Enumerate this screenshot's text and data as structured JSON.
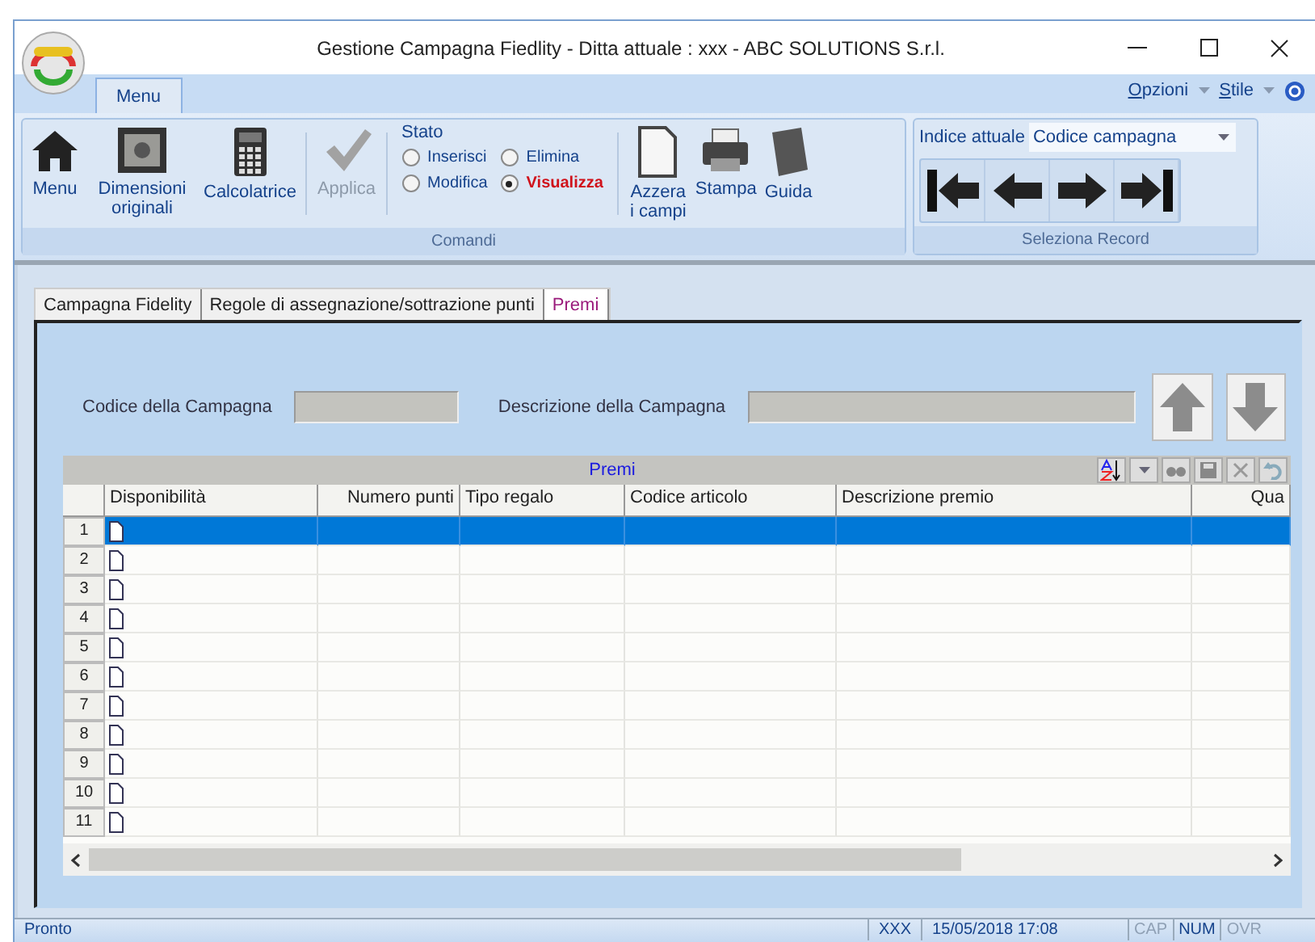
{
  "window": {
    "title": "Gestione Campagna Fiedlity - Ditta attuale : xxx - ABC SOLUTIONS S.r.l."
  },
  "ribbon_tabs": [
    {
      "label": "Menu",
      "selected": true
    }
  ],
  "ribbon_menu": [
    {
      "label": "Opzioni"
    },
    {
      "label": "Stile"
    }
  ],
  "commands": {
    "caption": "Comandi",
    "buttons": [
      {
        "kind": "home",
        "label": "Menu",
        "disabled": false
      },
      {
        "kind": "frame",
        "label": "Dimensioni originali",
        "disabled": false
      },
      {
        "kind": "calculator",
        "label": "Calcolatrice",
        "disabled": false
      },
      {
        "kind": "check",
        "label": "Applica",
        "disabled": true
      }
    ],
    "state_title": "Stato",
    "states": [
      {
        "label": "Inserisci",
        "selected": false
      },
      {
        "label": "Elimina",
        "selected": false
      },
      {
        "label": "Modifica",
        "selected": false
      },
      {
        "label": "Visualizza",
        "selected": true
      }
    ],
    "tools": [
      {
        "kind": "page",
        "label": "Azzera i campi"
      },
      {
        "kind": "printer",
        "label": "Stampa"
      },
      {
        "kind": "book",
        "label": "Guida"
      }
    ]
  },
  "record": {
    "caption": "Seleziona Record",
    "index_label": "Indice attuale",
    "index_value": "Codice campagna",
    "nav": [
      {
        "kind": "first"
      },
      {
        "kind": "prev"
      },
      {
        "kind": "next"
      },
      {
        "kind": "last"
      }
    ]
  },
  "tabs": [
    {
      "label": "Campagna Fidelity",
      "selected": false
    },
    {
      "label": "Regole di assegnazione/sottrazione punti",
      "selected": false
    },
    {
      "label": "Premi",
      "selected": true
    }
  ],
  "fields": [
    {
      "label": "Codice della Campagna"
    },
    {
      "label": "Descrizione della Campagna"
    }
  ],
  "grid": {
    "caption": "Premi",
    "columns": [
      {
        "label": "Disponibilità",
        "kind": "text"
      },
      {
        "label": "Numero punti",
        "kind": "number"
      },
      {
        "label": "Tipo regalo",
        "kind": "text"
      },
      {
        "label": "Codice articolo",
        "kind": "text"
      },
      {
        "label": "Descrizione premio",
        "kind": "text"
      },
      {
        "label": "Qua",
        "kind": "number"
      }
    ],
    "rows": [
      {
        "number": "1",
        "selected": true
      },
      {
        "number": "2",
        "selected": false
      },
      {
        "number": "3",
        "selected": false
      },
      {
        "number": "4",
        "selected": false
      },
      {
        "number": "5",
        "selected": false
      },
      {
        "number": "6",
        "selected": false
      },
      {
        "number": "7",
        "selected": false
      },
      {
        "number": "8",
        "selected": false
      },
      {
        "number": "9",
        "selected": false
      },
      {
        "number": "10",
        "selected": false
      },
      {
        "number": "11",
        "selected": false
      }
    ]
  },
  "status_bar": {
    "message": "Pronto",
    "user": "XXX",
    "datetime": "15/05/2018 17:08",
    "indicators": [
      {
        "label": "CAP",
        "on": false
      },
      {
        "label": "NUM",
        "on": true
      },
      {
        "label": "OVR",
        "on": false
      }
    ]
  }
}
